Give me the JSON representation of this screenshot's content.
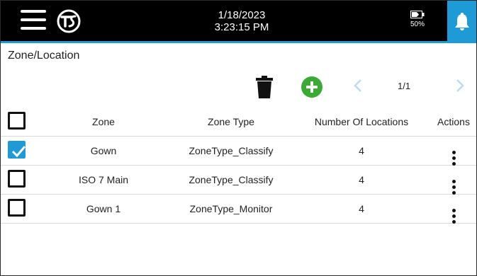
{
  "header": {
    "date": "1/18/2023",
    "time": "3:23:15 PM",
    "battery_level": "50%",
    "icons": {
      "menu": "menu-icon",
      "logo": "tsi-logo",
      "battery": "battery-icon",
      "notifications": "bell-icon"
    }
  },
  "page": {
    "title": "Zone/Location"
  },
  "toolbar": {
    "delete_icon": "trash-icon",
    "add_icon": "plus-circle-icon",
    "prev_icon": "chevron-left-icon",
    "next_icon": "chevron-right-icon",
    "page_indicator": "1/1"
  },
  "table": {
    "columns": {
      "zone": "Zone",
      "zone_type": "Zone Type",
      "number_of_locations": "Number Of Locations",
      "actions": "Actions"
    },
    "rows": [
      {
        "zone": "Gown",
        "zone_type": "ZoneType_Classify",
        "number_of_locations": "4",
        "checked": true
      },
      {
        "zone": "ISO 7 Main",
        "zone_type": "ZoneType_Classify",
        "number_of_locations": "4",
        "checked": false
      },
      {
        "zone": "Gown 1",
        "zone_type": "ZoneType_Monitor",
        "number_of_locations": "4",
        "checked": false
      }
    ]
  },
  "colors": {
    "accent": "#1e9ad6",
    "add_green": "#3aaa35",
    "topbar": "#000000"
  }
}
